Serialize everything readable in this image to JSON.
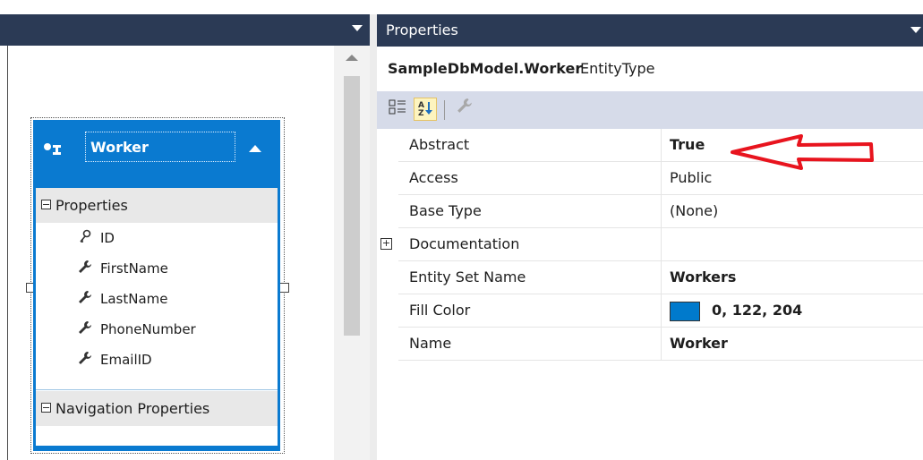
{
  "entity": {
    "name": "Worker",
    "properties_header": "Properties",
    "properties": [
      "ID",
      "FirstName",
      "LastName",
      "PhoneNumber",
      "EmailID"
    ],
    "navigation_header": "Navigation Properties",
    "fill_color": "#007acc"
  },
  "properties_window": {
    "title": "Properties",
    "object_name": "SampleDbModel.Worker",
    "object_type": "EntityType",
    "rows": [
      {
        "key": "Abstract",
        "value": "True"
      },
      {
        "key": "Access",
        "value": "Public"
      },
      {
        "key": "Base Type",
        "value": "(None)"
      },
      {
        "key": "Documentation",
        "value": ""
      },
      {
        "key": "Entity Set Name",
        "value": "Workers"
      },
      {
        "key": "Fill Color",
        "value": "0, 122, 204"
      },
      {
        "key": "Name",
        "value": "Worker"
      }
    ]
  },
  "annotation": {
    "arrow_color": "#e8141e"
  },
  "icons": {
    "designer_dropdown": "chevron-down-icon",
    "entity": "entity-type-icon",
    "key_property": "key-icon",
    "scalar_property": "wrench-icon",
    "categorized": "categorized-icon",
    "alphabetical": "sort-alphabetical-icon",
    "property_pages": "property-pages-icon"
  }
}
